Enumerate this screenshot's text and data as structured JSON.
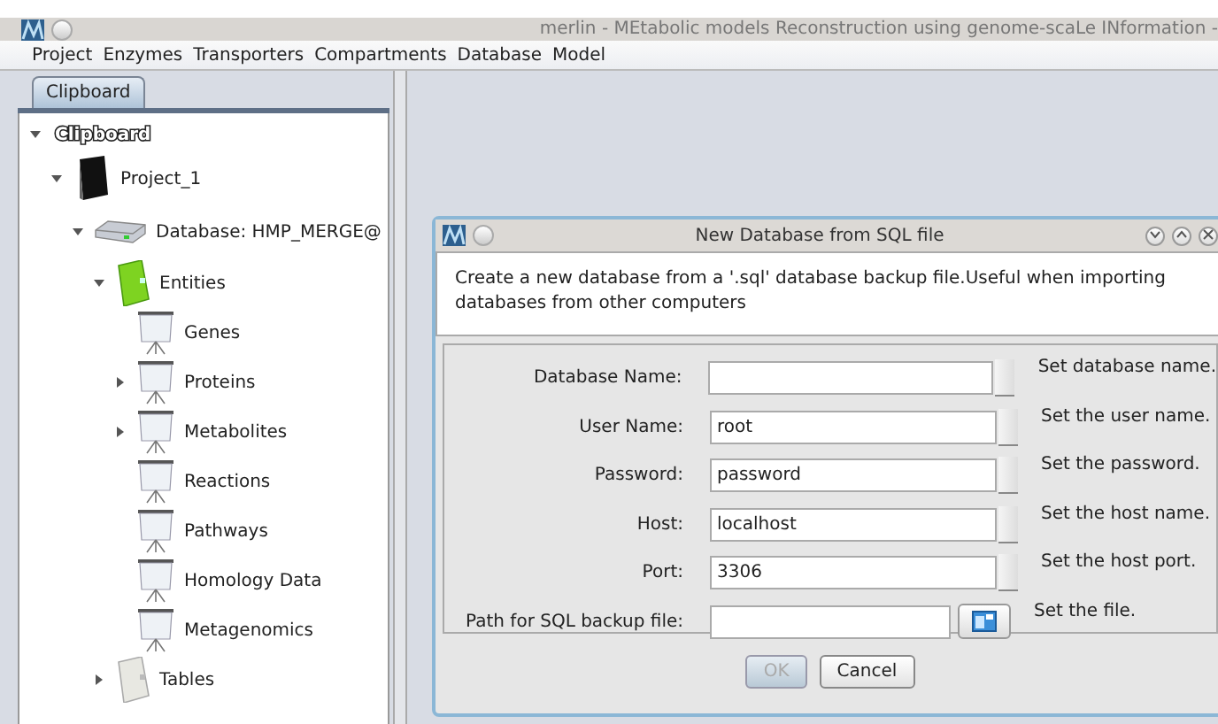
{
  "window": {
    "title": "merlin -  MEtabolic models Reconstruction using genome-scaLe INformation -"
  },
  "menu": [
    "Project",
    "Enzymes",
    "Transporters",
    "Compartments",
    "Database",
    "Model"
  ],
  "tabs": [
    {
      "label": "Clipboard",
      "selected": true
    }
  ],
  "tree": [
    {
      "label": "Clipboard",
      "kind": "root",
      "expanded": true,
      "children": [
        {
          "label": "Project_1",
          "kind": "project",
          "expanded": true,
          "children": [
            {
              "label": "Database: HMP_MERGE@",
              "kind": "database",
              "expanded": true,
              "children": [
                {
                  "label": "Entities",
                  "kind": "folder",
                  "expanded": true,
                  "children": [
                    {
                      "label": "Genes",
                      "kind": "table"
                    },
                    {
                      "label": "Proteins",
                      "kind": "table",
                      "expanded": false
                    },
                    {
                      "label": "Metabolites",
                      "kind": "table",
                      "expanded": false
                    },
                    {
                      "label": "Reactions",
                      "kind": "table"
                    },
                    {
                      "label": "Pathways",
                      "kind": "table"
                    },
                    {
                      "label": "Homology Data",
                      "kind": "table"
                    },
                    {
                      "label": "Metagenomics",
                      "kind": "table"
                    }
                  ]
                },
                {
                  "label": "Tables",
                  "kind": "empty-folder",
                  "expanded": false
                }
              ]
            }
          ]
        }
      ]
    }
  ],
  "dialog": {
    "title": "New Database from SQL file",
    "description": "Create a new database from a '.sql' database backup file.Useful when importing databases from other computers",
    "fields": [
      {
        "kind": "text",
        "label": "Database Name:",
        "hint": "Set database name."
      },
      {
        "kind": "text",
        "label": "User Name:",
        "value": "root",
        "hint": "Set the user name."
      },
      {
        "kind": "text",
        "label": "Password:",
        "value": "password",
        "hint": "Set the password."
      },
      {
        "kind": "text",
        "label": "Host:",
        "value": "localhost",
        "hint": "Set the host name."
      },
      {
        "kind": "text",
        "label": "Port:",
        "value": "3306",
        "hint": "Set the host port."
      },
      {
        "kind": "file",
        "label": "Path for SQL backup file:",
        "hint": "Set the file."
      }
    ],
    "buttons": [
      {
        "label": "OK",
        "disabled": true
      },
      {
        "label": "Cancel",
        "disabled": false
      }
    ]
  }
}
